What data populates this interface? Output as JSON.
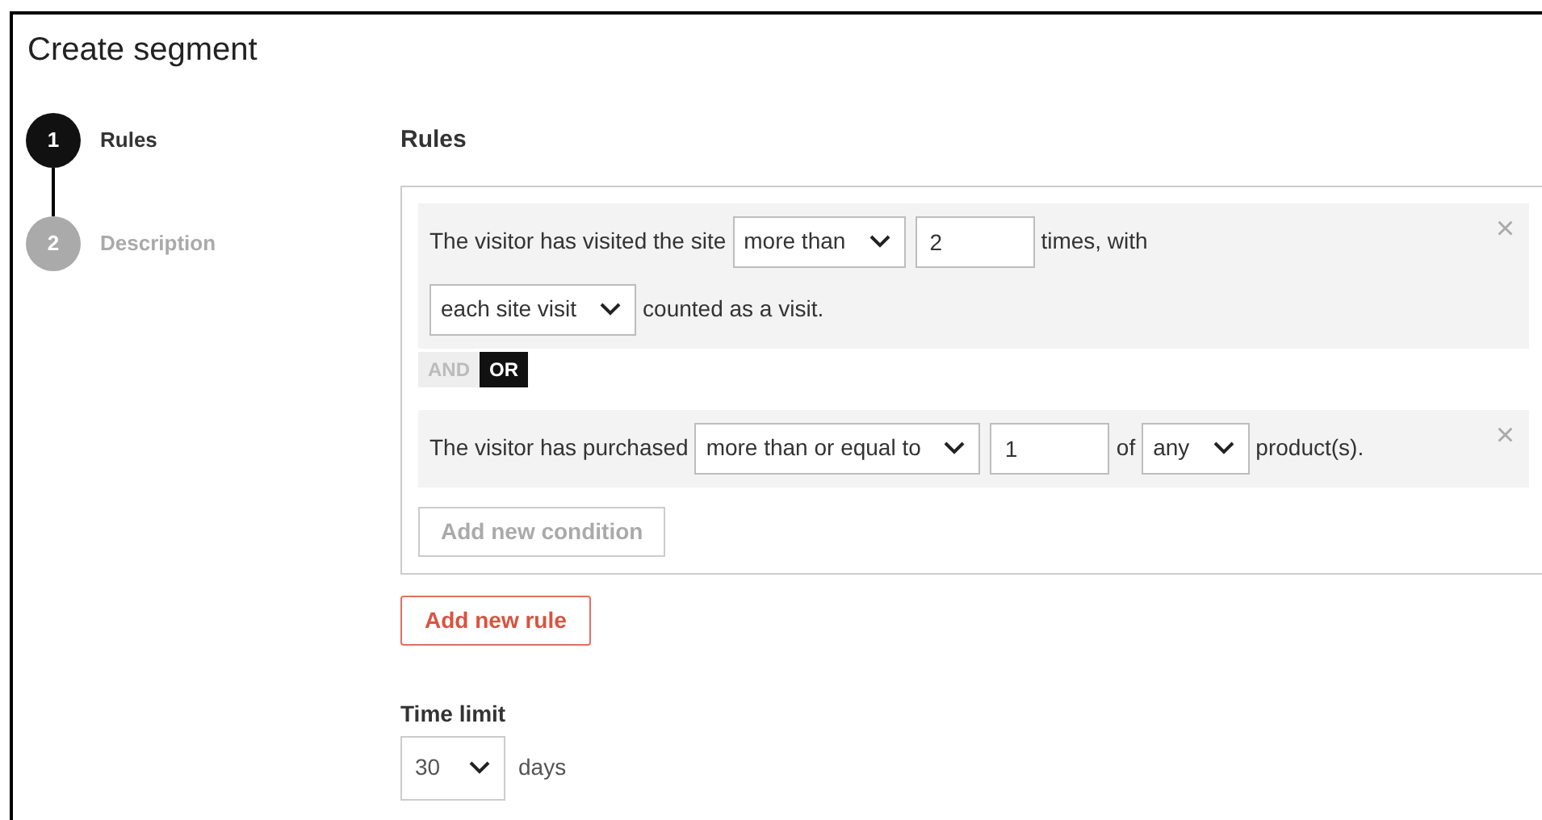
{
  "title": "Create segment",
  "steps": [
    {
      "number": "1",
      "label": "Rules",
      "selected": true
    },
    {
      "number": "2",
      "label": "Description",
      "selected": false
    }
  ],
  "rules": {
    "heading": "Rules",
    "conditions": [
      {
        "lines": [
          [
            {
              "kind": "text",
              "text": "The visitor has visited the site"
            },
            {
              "kind": "select",
              "value": "more than"
            },
            {
              "kind": "input",
              "value": "2"
            },
            {
              "kind": "text",
              "text": "times, with"
            }
          ],
          [
            {
              "kind": "select",
              "value": "each site visit"
            },
            {
              "kind": "text",
              "text": "counted as a visit."
            }
          ]
        ],
        "close": "×"
      },
      {
        "lines": [
          [
            {
              "kind": "text",
              "text": "The visitor has purchased"
            },
            {
              "kind": "select",
              "value": "more than or equal to"
            },
            {
              "kind": "input",
              "value": "1"
            },
            {
              "kind": "text",
              "text": "of"
            },
            {
              "kind": "select",
              "value": "any"
            },
            {
              "kind": "text",
              "text": "product(s)."
            }
          ]
        ],
        "close": "×"
      }
    ],
    "operators": [
      {
        "label": "AND",
        "selected": false
      },
      {
        "label": "OR",
        "selected": true
      }
    ],
    "add_condition": "Add new condition"
  },
  "add_rule": "Add new rule",
  "time_limit": {
    "label": "Time limit",
    "value": "30",
    "unit": "days"
  }
}
